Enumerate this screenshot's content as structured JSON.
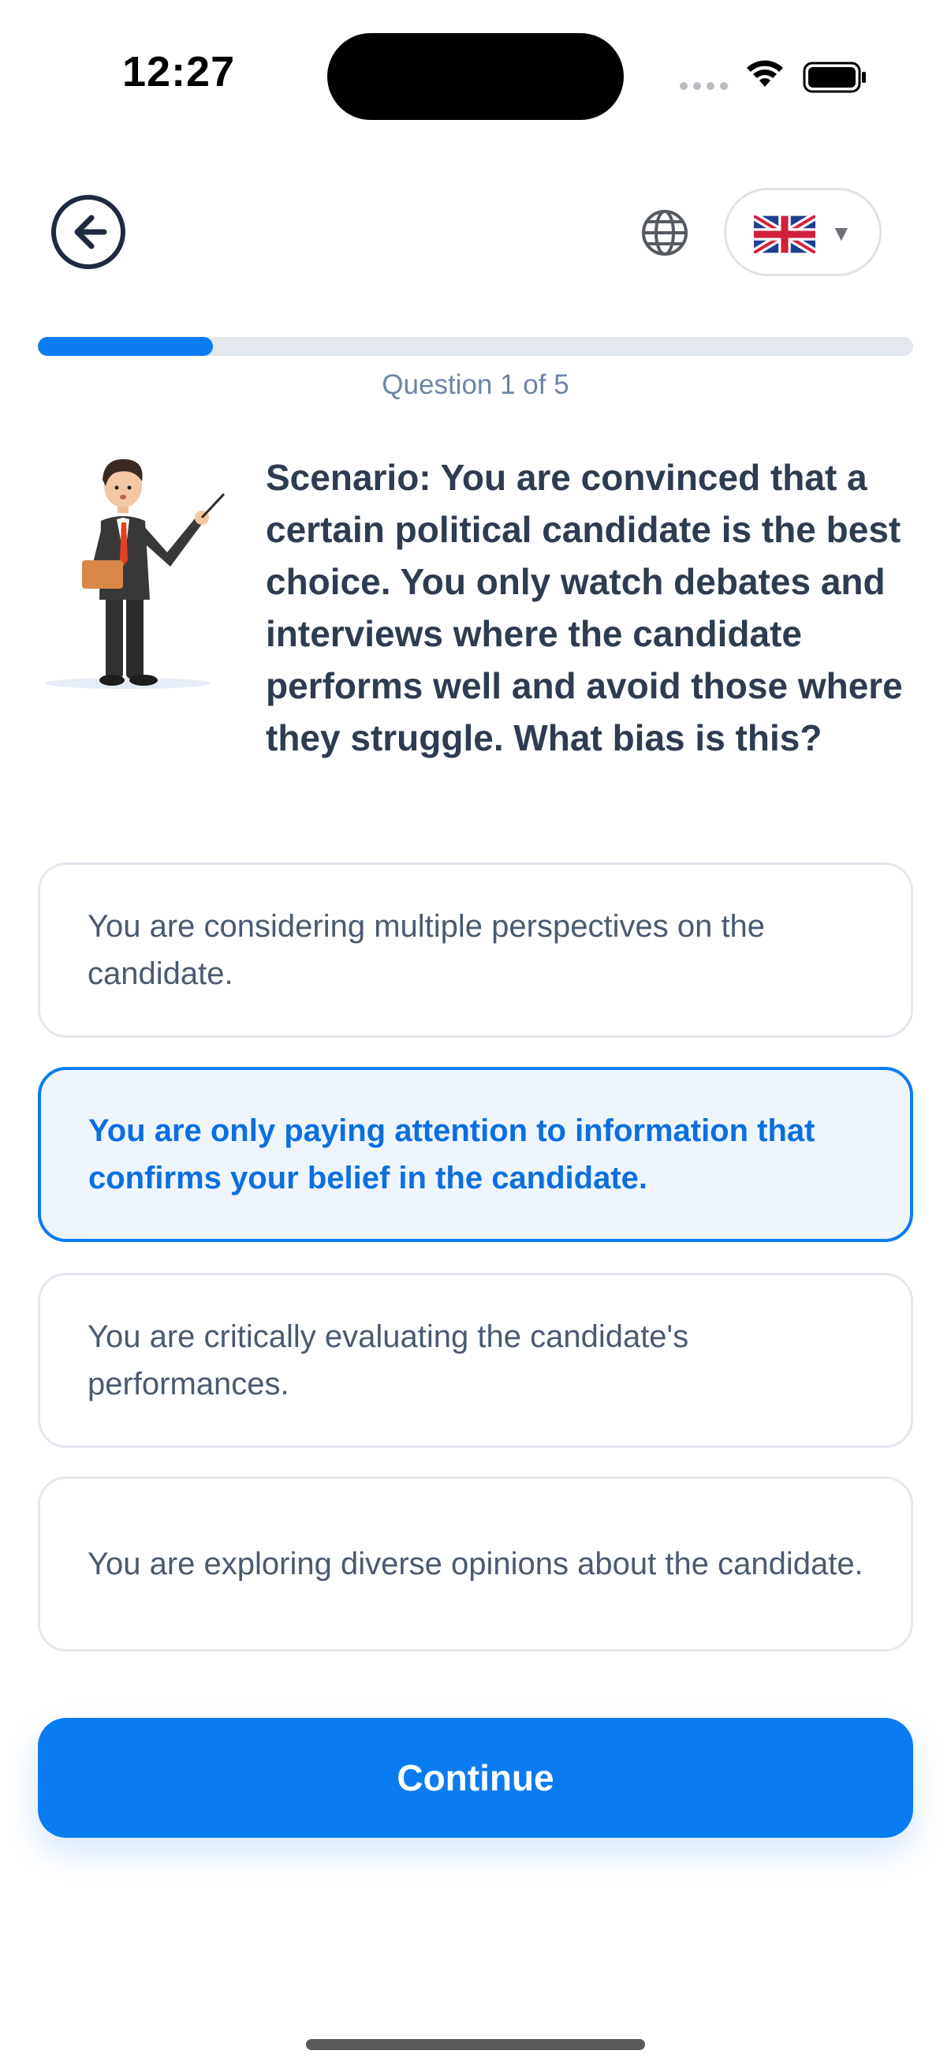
{
  "status_bar": {
    "time": "12:27"
  },
  "header": {
    "back_icon": "arrow-left-circle-icon",
    "globe_icon": "globe-icon",
    "language_flag": "uk-flag-icon",
    "language_caret": "▼"
  },
  "progress": {
    "label": "Question 1 of 5",
    "current": 1,
    "total": 5,
    "fraction": 0.2,
    "fill_color": "#0a7cf2",
    "track_color": "#e3e8ef"
  },
  "question": {
    "illustration": "teacher-with-pointer-illustration",
    "text": "Scenario: You are convinced that a certain political candidate is the best choice. You only watch debates and interviews where the candidate performs well and avoid those where they struggle. What bias is this?"
  },
  "options": [
    {
      "text": "You are considering multiple perspectives on the candidate.",
      "selected": false
    },
    {
      "text": "You are only paying attention to information that confirms your belief in the candidate.",
      "selected": true
    },
    {
      "text": "You are critically evaluating the candidate's performances.",
      "selected": false
    },
    {
      "text": "You are exploring diverse opinions about the candidate.",
      "selected": false
    }
  ],
  "continue_label": "Continue",
  "colors": {
    "accent": "#0a7cf2",
    "question_text": "#2e3c50",
    "option_text": "#4a5a70",
    "selected_bg": "#eef5fd"
  }
}
